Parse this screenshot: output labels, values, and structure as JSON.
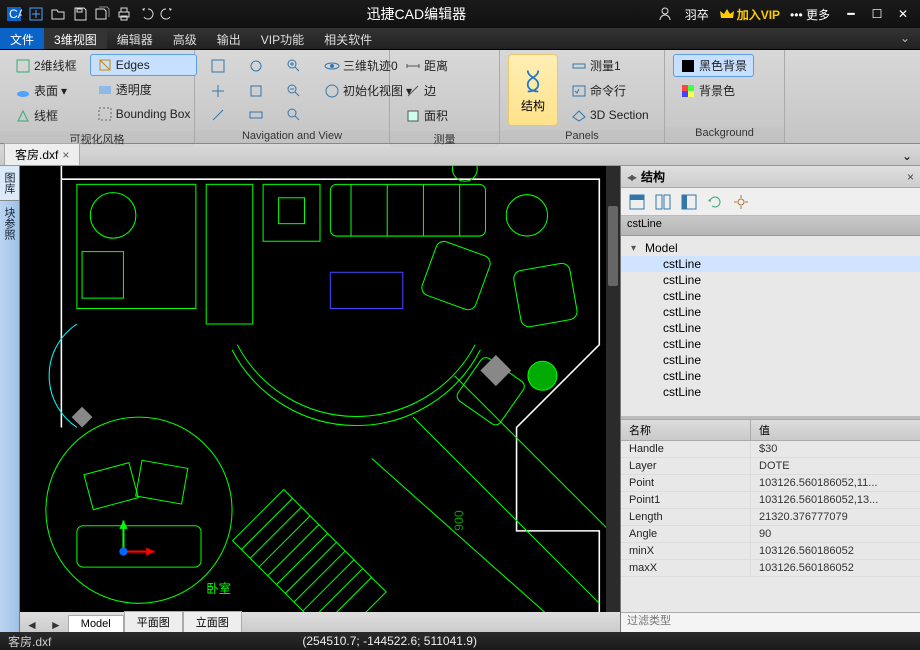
{
  "title": "迅捷CAD编辑器",
  "user": "羽卒",
  "vip": "加入VIP",
  "more": "更多",
  "menus": [
    "文件",
    "3维视图",
    "编辑器",
    "高级",
    "输出",
    "VIP功能",
    "相关软件"
  ],
  "active_menu": 1,
  "ribbon": {
    "g1": {
      "label": "可视化风格",
      "b1": "2维线框",
      "b2": "Edges",
      "b3": "表面",
      "b4": "透明度",
      "b5": "线框",
      "b6": "Bounding Box"
    },
    "g2": {
      "label": "Navigation and View",
      "b1": "三维轨迹0",
      "b2": "初始化视图"
    },
    "g3": {
      "label": "测量",
      "b1": "距离",
      "b2": "边",
      "b3": "面积"
    },
    "g4": {
      "label": "Panels",
      "big": "结构",
      "b1": "测量1",
      "b2": "命令行",
      "b3": "3D Section"
    },
    "g5": {
      "label": "Background",
      "b1": "黑色背景",
      "b2": "背景色"
    }
  },
  "doc": {
    "name": "客房.dxf"
  },
  "left_tabs": [
    "图库",
    "块参照"
  ],
  "view_tabs": [
    "Model",
    "平面图",
    "立面图"
  ],
  "active_view": 0,
  "struct": {
    "title": "结构",
    "selhdr": "cstLine",
    "root": "Model",
    "children": [
      "cstLine",
      "cstLine",
      "cstLine",
      "cstLine",
      "cstLine",
      "cstLine",
      "cstLine",
      "cstLine",
      "cstLine"
    ]
  },
  "props": {
    "hdr_name": "名称",
    "hdr_value": "值",
    "rows": [
      {
        "n": "Handle",
        "v": "$30"
      },
      {
        "n": "Layer",
        "v": "DOTE"
      },
      {
        "n": "Point",
        "v": "103126.560186052,11..."
      },
      {
        "n": "Point1",
        "v": "103126.560186052,13..."
      },
      {
        "n": "Length",
        "v": "21320.376777079"
      },
      {
        "n": "Angle",
        "v": "90"
      },
      {
        "n": "minX",
        "v": "103126.560186052"
      },
      {
        "n": "maxX",
        "v": "103126.560186052"
      }
    ],
    "filter_ph": "过滤类型"
  },
  "status": {
    "file": "客房.dxf",
    "coords": "(254510.7; -144522.6; 511041.9)"
  },
  "canvas_text": "卧室"
}
